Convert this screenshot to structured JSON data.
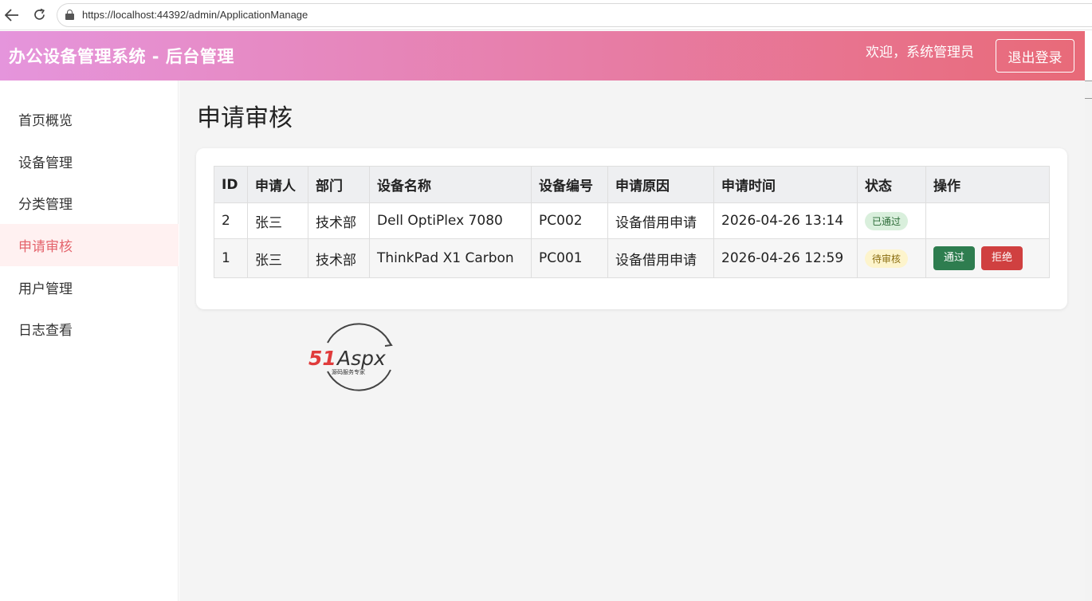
{
  "browser": {
    "url": "https://localhost:44392/admin/ApplicationManage"
  },
  "header": {
    "title": "办公设备管理系统 - 后台管理",
    "welcome": "欢迎，系统管理员",
    "logout_label": "退出登录"
  },
  "sidebar": {
    "items": [
      {
        "label": "首页概览"
      },
      {
        "label": "设备管理"
      },
      {
        "label": "分类管理"
      },
      {
        "label": "申请审核"
      },
      {
        "label": "用户管理"
      },
      {
        "label": "日志查看"
      }
    ],
    "active_index": 3
  },
  "main": {
    "title": "申请审核",
    "table": {
      "headers": [
        "ID",
        "申请人",
        "部门",
        "设备名称",
        "设备编号",
        "申请原因",
        "申请时间",
        "状态",
        "操作"
      ],
      "rows": [
        {
          "id": "2",
          "applicant": "张三",
          "dept": "技术部",
          "device": "Dell OptiPlex 7080",
          "code": "PC002",
          "reason": "设备借用申请",
          "time": "2026-04-26 13:14",
          "status": "已通过",
          "actions": []
        },
        {
          "id": "1",
          "applicant": "张三",
          "dept": "技术部",
          "device": "ThinkPad X1 Carbon",
          "code": "PC001",
          "reason": "设备借用申请",
          "time": "2026-04-26 12:59",
          "status": "待审核",
          "actions": [
            "通过",
            "拒绝"
          ]
        }
      ]
    }
  },
  "logo": {
    "brand_red": "51",
    "brand_dark": "Aspx",
    "tagline": "源码服务专家"
  },
  "colors": {
    "header_gradient_start": "#e595dc",
    "header_gradient_end": "#e86a78",
    "active_text": "#e4646c",
    "active_bg": "#fff1f1",
    "pass_button": "#2e7d4f",
    "reject_button": "#d04040"
  }
}
